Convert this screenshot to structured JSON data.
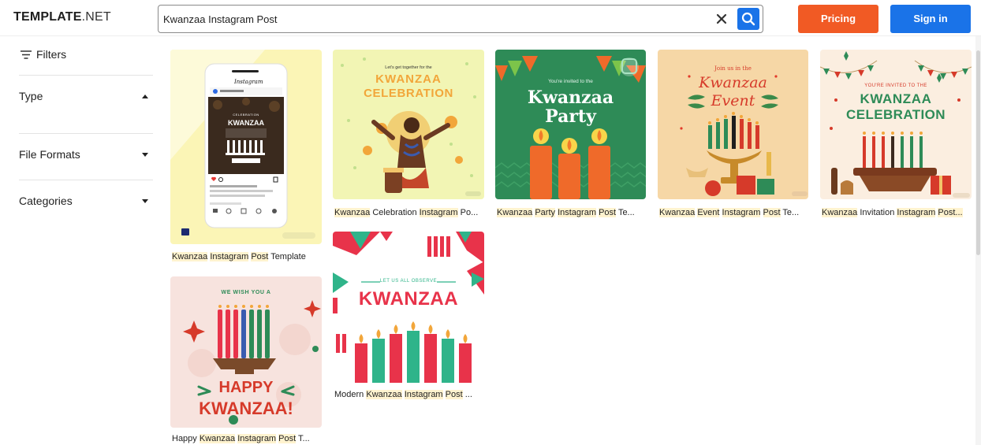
{
  "header": {
    "logo_bold": "TEMPLATE",
    "logo_light": ".NET",
    "search_value": "Kwanzaa Instagram Post",
    "pricing_label": "Pricing",
    "signin_label": "Sign in",
    "icons": [
      "close-icon",
      "search-icon"
    ]
  },
  "sidebar": {
    "filters_label": "Filters",
    "sections": [
      {
        "label": "Type",
        "state": "expanded"
      },
      {
        "label": "File Formats",
        "state": "collapsed"
      },
      {
        "label": "Categories",
        "state": "collapsed"
      }
    ]
  },
  "cards": [
    {
      "caption_words": [
        "Kwanzaa",
        "Instagram",
        "Post",
        "Template"
      ],
      "phone": {
        "app_label": "Instagram",
        "post_title": "KWANZAA",
        "post_sub": "CELEBRATION"
      }
    },
    {
      "caption_words": [
        "Kwanzaa",
        "Celebration",
        "Instagram",
        "Po..."
      ],
      "art": {
        "small": "Let's get together for the",
        "line1": "KWANZAA",
        "line2": "CELEBRATION"
      }
    },
    {
      "caption_words": [
        "Kwanzaa",
        "Party",
        "Instagram",
        "Post",
        "Te..."
      ],
      "art": {
        "small": "You're invited to the",
        "line1": "Kwanzaa",
        "line2": "Party"
      }
    },
    {
      "caption_words": [
        "Kwanzaa",
        "Event",
        "Instagram",
        "Post",
        "Te..."
      ],
      "art": {
        "small": "Join us in the",
        "line1": "Kwanzaa",
        "line2": "Event"
      }
    },
    {
      "caption_words": [
        "Kwanzaa",
        "Invitation",
        "Instagram",
        "Post..."
      ],
      "art": {
        "small": "YOU'RE INVITED TO THE",
        "line1": "KWANZAA",
        "line2": "CELEBRATION"
      }
    },
    {
      "caption_words": [
        "Modern",
        "Kwanzaa",
        "Instagram",
        "Post",
        "..."
      ],
      "art": {
        "small": "LET US ALL OBSERVE",
        "line1": "KWANZAA"
      }
    },
    {
      "caption_words": [
        "Happy",
        "Kwanzaa",
        "Instagram",
        "Post",
        "T..."
      ],
      "art": {
        "small": "WE WISH YOU A",
        "line1": "HAPPY",
        "line2": "KWANZAA!"
      }
    }
  ],
  "colors": {
    "brand_orange": "#f15a24",
    "brand_blue": "#1a73e8",
    "kwanzaa_green": "#2e8b57",
    "kwanzaa_red": "#e53935"
  }
}
